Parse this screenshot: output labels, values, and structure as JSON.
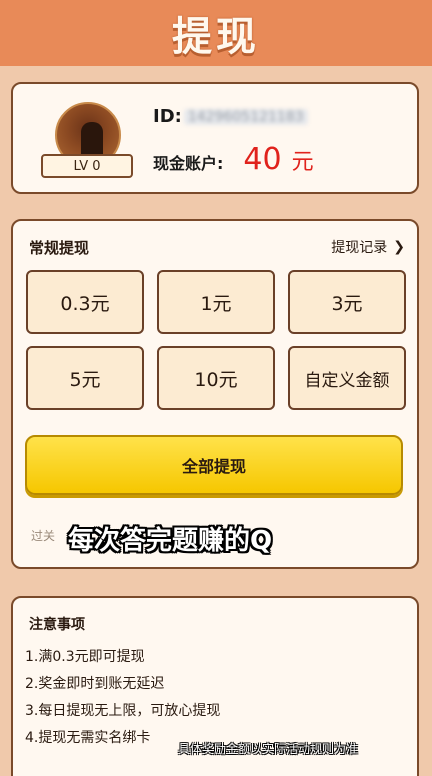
{
  "header": {
    "title": "提现"
  },
  "profile": {
    "level": "LV 0",
    "id_label": "ID:",
    "id_value": "1429605121183",
    "balance_label": "现金账户:",
    "balance_amount": "40",
    "balance_unit": "元"
  },
  "withdraw": {
    "title": "常规提现",
    "records_label": "提现记录",
    "options": [
      "0.3元",
      "1元",
      "3元",
      "5元",
      "10元",
      "自定义金额"
    ],
    "all_button": "全部提现",
    "tip": "过关"
  },
  "notice": {
    "title": "注意事项",
    "items": [
      "1.满0.3元即可提现",
      "2.奖金即时到账无延迟",
      "3.每日提现无上限，可放心提现",
      "4.提现无需实名绑卡"
    ]
  },
  "overlay": {
    "caption": "每次答完题赚的Q",
    "disclaimer": "具体奖励金额以实际活动规则为准"
  },
  "colors": {
    "header_bg": "#e88a58",
    "page_bg": "#f0c9ab",
    "balance": "#e0221c",
    "button": "#f6c700"
  }
}
